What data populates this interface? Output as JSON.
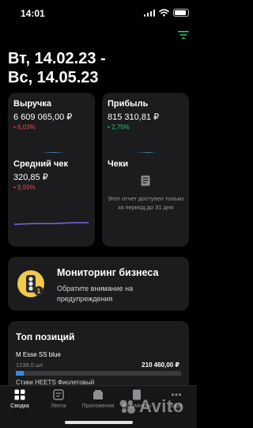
{
  "status_bar": {
    "time": "14:01",
    "battery_level": 0.85
  },
  "header": {
    "period_title": "Вт, 14.02.23 -\nВс, 14.05.23",
    "filter_icon": "filter-icon"
  },
  "colors": {
    "background": "#000000",
    "card": "#1c1c1e",
    "negative": "#e5484d",
    "positive": "#30c27b",
    "chart_line_main": "#4fa3e6",
    "chart_line_avg": "#7f6ad8",
    "top_bar": "#2f8de4",
    "accent_green": "#30c27b"
  },
  "metrics": [
    {
      "title": "Выручка",
      "value": "6 609 065,00 ₽",
      "delta": "• 6,03%",
      "direction": "down"
    },
    {
      "title": "Прибыль",
      "value": "815 310,81 ₽",
      "delta": "• 2,75%",
      "direction": "up"
    },
    {
      "title": "Средний чек",
      "value": "320,85 ₽",
      "delta": "• 9,93%",
      "direction": "down"
    }
  ],
  "reports": {
    "title": "Чеки",
    "icon": "document-icon",
    "note": "Этот отчет доступен только за период до 31 дня"
  },
  "monitoring": {
    "title": "Мониторинг бизнеса",
    "subtitle": "Обратите внимание на предупреждения",
    "icon": "traffic-light-icon",
    "badge": "1"
  },
  "top_positions": {
    "title": "Топ позиций",
    "items": [
      {
        "name": "M Esse SS blue",
        "qty": "1238.0 шт",
        "sum": "210 460,00 ₽",
        "share": 0.05
      },
      {
        "name": "Стики HEETS Фиолетовый"
      }
    ]
  },
  "tabs": [
    {
      "label": "Сводка",
      "icon": "summary-icon",
      "active": true
    },
    {
      "label": "Лента",
      "icon": "feed-icon",
      "active": false
    },
    {
      "label": "Приложения",
      "icon": "apps-icon",
      "active": false
    },
    {
      "label": "Документы",
      "icon": "documents-icon",
      "active": false
    },
    {
      "label": "Еще",
      "icon": "more-icon",
      "active": false
    }
  ],
  "watermark": {
    "text": "Avito",
    "icon": "avito-logo-icon"
  }
}
